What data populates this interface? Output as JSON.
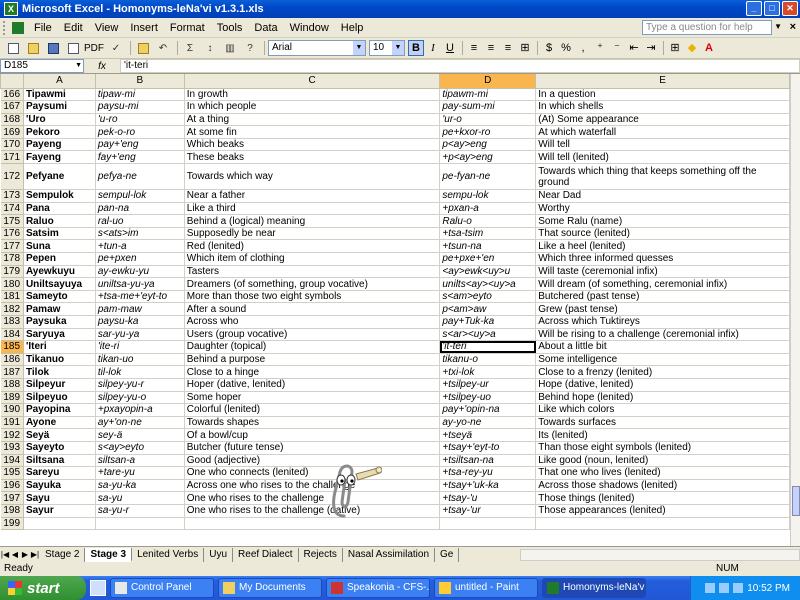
{
  "window": {
    "title": "Microsoft Excel - Homonyms-leNa'vi v1.3.1.xls",
    "app_icon": "excel-icon"
  },
  "menu": [
    "File",
    "Edit",
    "View",
    "Insert",
    "Format",
    "Tools",
    "Data",
    "Window",
    "Help"
  ],
  "help_placeholder": "Type a question for help",
  "toolbar": {
    "pdf_label": "PDF",
    "font": "Arial",
    "font_size": "10",
    "bold": "B",
    "italic": "I",
    "underline": "U",
    "currency": "$",
    "percent": "%",
    "comma": ",",
    "sum": "Σ"
  },
  "formula_bar": {
    "cell_ref": "D185",
    "fx": "fx",
    "content": "'it-teri"
  },
  "columns": [
    "A",
    "B",
    "C",
    "D",
    "E"
  ],
  "selected_column": "D",
  "active_row": "185",
  "rows": [
    {
      "n": "166",
      "a": "Tipawmi",
      "b": "tipaw-mi",
      "c": "In growth",
      "d": "tipawm-mi",
      "e": "In a question"
    },
    {
      "n": "167",
      "a": "Paysumi",
      "b": "paysu-mi",
      "c": "In which people",
      "d": "pay-sum-mi",
      "e": "In which shells"
    },
    {
      "n": "168",
      "a": "'Uro",
      "b": "'u-ro",
      "c": "At a thing",
      "d": "'ur-o",
      "e": "(At) Some appearance"
    },
    {
      "n": "169",
      "a": "Pekoro",
      "b": "pek-o-ro",
      "c": "At some fin",
      "d": "pe+kxor-ro",
      "e": "At which waterfall"
    },
    {
      "n": "170",
      "a": "Payeng",
      "b": "pay+'eng",
      "c": "Which beaks",
      "d": "p<ay>eng",
      "e": "Will tell"
    },
    {
      "n": "171",
      "a": "Fayeng",
      "b": "fay+'eng",
      "c": "These beaks",
      "d": "+p<ay>eng",
      "e": "Will tell (lenited)"
    },
    {
      "n": "172",
      "a": "Pefyane",
      "b": "pefya-ne",
      "c": "Towards which way",
      "d": "pe-fyan-ne",
      "e": "Towards which thing that keeps something off the ground",
      "tall": true
    },
    {
      "n": "173",
      "a": "Sempulok",
      "b": "sempul-lok",
      "c": "Near a father",
      "d": "sempu-lok",
      "e": "Near Dad"
    },
    {
      "n": "174",
      "a": "Pana",
      "b": "pan-na",
      "c": "Like a third",
      "d": "+pxan-a",
      "e": "Worthy"
    },
    {
      "n": "175",
      "a": "Raluo",
      "b": "ral-uo",
      "c": "Behind a (logical) meaning",
      "d": "Ralu-o",
      "e": "Some Ralu (name)"
    },
    {
      "n": "176",
      "a": "Satsim",
      "b": "s<ats>im",
      "c": "Supposedly be near",
      "d": "+tsa-tsim",
      "e": "That source (lenited)"
    },
    {
      "n": "177",
      "a": "Suna",
      "b": "+tun-a",
      "c": "Red (lenited)",
      "d": "+tsun-na",
      "e": "Like a heel (lenited)"
    },
    {
      "n": "178",
      "a": "Pepen",
      "b": "pe+pxen",
      "c": "Which item of clothing",
      "d": "pe+pxe+'en",
      "e": "Which three informed quesses"
    },
    {
      "n": "179",
      "a": "Ayewkuyu",
      "b": "ay-ewku-yu",
      "c": "Tasters",
      "d": "<ay>ewk<uy>u",
      "e": "Will taste (ceremonial infix)"
    },
    {
      "n": "180",
      "a": "Uniltsayuya",
      "b": "uniltsa-yu-ya",
      "c": "Dreamers (of something, group vocative)",
      "d": "unilts<ay><uy>a",
      "e": "Will dream (of something, ceremonial infix)"
    },
    {
      "n": "181",
      "a": "Sameyto",
      "b": "+tsa-me+'eyt-to",
      "c": "More than those two eight symbols",
      "d": "s<am>eyto",
      "e": "Butchered (past tense)"
    },
    {
      "n": "182",
      "a": "Pamaw",
      "b": "pam-maw",
      "c": "After a sound",
      "d": "p<am>aw",
      "e": "Grew (past tense)"
    },
    {
      "n": "183",
      "a": "Paysuka",
      "b": "paysu-ka",
      "c": "Across who",
      "d": "pay+Tuk-ka",
      "e": "Across which Tuktireys"
    },
    {
      "n": "184",
      "a": "Saryuya",
      "b": "sar-yu-ya",
      "c": "Users (group vocative)",
      "d": "s<ar><uy>a",
      "e": "Will be rising to a challenge (ceremonial infix)"
    },
    {
      "n": "185",
      "a": "'Iteri",
      "b": "'ite-ri",
      "c": "Daughter (topical)",
      "d": "'it-teri",
      "e": "About a little bit"
    },
    {
      "n": "186",
      "a": "Tikanuo",
      "b": "tikan-uo",
      "c": "Behind a purpose",
      "d": "tikanu-o",
      "e": "Some intelligence"
    },
    {
      "n": "187",
      "a": "Tilok",
      "b": "til-lok",
      "c": "Close to a hinge",
      "d": "+txi-lok",
      "e": "Close to a frenzy (lenited)"
    },
    {
      "n": "188",
      "a": "Silpeyur",
      "b": "silpey-yu-r",
      "c": "Hoper (dative, lenited)",
      "d": "+tsilpey-ur",
      "e": "Hope (dative, lenited)"
    },
    {
      "n": "189",
      "a": "Silpeyuo",
      "b": "silpey-yu-o",
      "c": "Some hoper",
      "d": "+tsilpey-uo",
      "e": "Behind hope (lenited)"
    },
    {
      "n": "190",
      "a": "Payopina",
      "b": "+pxayopin-a",
      "c": "Colorful (lenited)",
      "d": "pay+'opin-na",
      "e": "Like which colors"
    },
    {
      "n": "191",
      "a": "Ayone",
      "b": "ay+'on-ne",
      "c": "Towards shapes",
      "d": "ay-yo-ne",
      "e": "Towards surfaces"
    },
    {
      "n": "192",
      "a": "Seyä",
      "b": "sey-ä",
      "c": "Of a bowl/cup",
      "d": "+tseyä",
      "e": "Its (lenited)"
    },
    {
      "n": "193",
      "a": "Sayeyto",
      "b": "s<ay>eyto",
      "c": "Butcher (future tense)",
      "d": "+tsay+'eyt-to",
      "e": "Than those eight symbols (lenited)"
    },
    {
      "n": "194",
      "a": "Siltsana",
      "b": "siltsan-a",
      "c": "Good (adjective)",
      "d": "+tsiltsan-na",
      "e": "Like good (noun, lenited)"
    },
    {
      "n": "195",
      "a": "Sareyu",
      "b": "+tare-yu",
      "c": "One who connects (lenited)",
      "d": "+tsa-rey-yu",
      "e": "That one who lives (lenited)"
    },
    {
      "n": "196",
      "a": "Sayuka",
      "b": "sa-yu-ka",
      "c": "Across one who rises to the challenge",
      "d": "+tsay+'uk-ka",
      "e": "Across those shadows (lenited)"
    },
    {
      "n": "197",
      "a": "Sayu",
      "b": "sa-yu",
      "c": "One who rises to the challenge",
      "d": "+tsay-'u",
      "e": "Those things (lenited)"
    },
    {
      "n": "198",
      "a": "Sayur",
      "b": "sa-yu-r",
      "c": "One who rises to the challenge (dative)",
      "d": "+tsay-'ur",
      "e": "Those appearances (lenited)"
    },
    {
      "n": "199",
      "a": "",
      "b": "",
      "c": "",
      "d": "",
      "e": ""
    }
  ],
  "sheet_tabs": [
    "Stage 2",
    "Stage 3",
    "Lenited Verbs",
    "Uyu",
    "Reef Dialect",
    "Rejects",
    "Nasal Assimilation",
    "Ge"
  ],
  "active_sheet": "Stage 3",
  "status": {
    "left": "Ready",
    "num": "NUM"
  },
  "taskbar": {
    "start": "start",
    "tasks": [
      "Control Panel",
      "My Documents",
      "Speakonia - CFS-...",
      "untitled - Paint",
      "Homonyms-leNa'vi..."
    ],
    "active_task": "Homonyms-leNa'vi...",
    "clock": "10:52 PM"
  },
  "colors": {
    "title_bar": "#0048c8",
    "selection": "#f9b64f",
    "chrome": "#ece9d8",
    "start_button": "#2f8f2f"
  }
}
